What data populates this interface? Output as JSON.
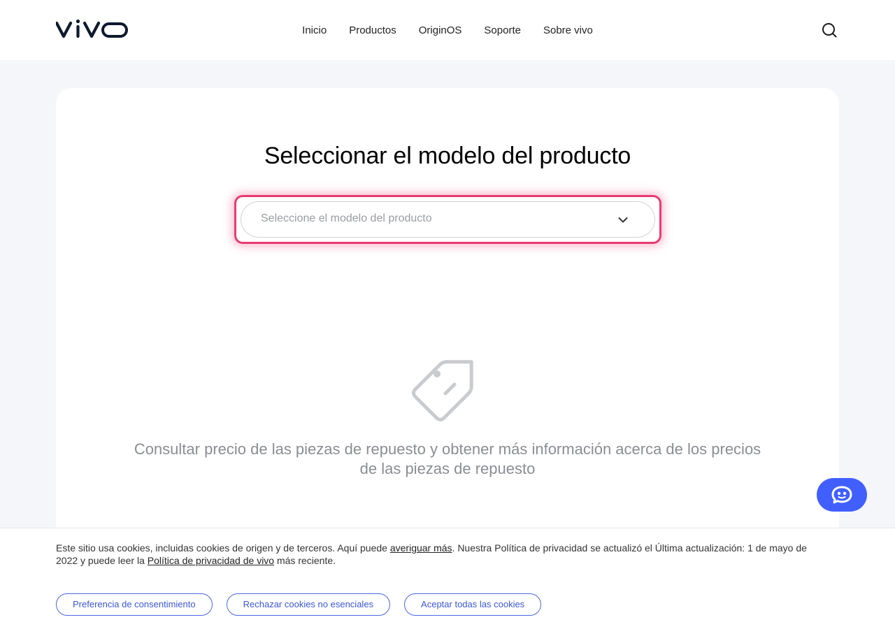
{
  "header": {
    "logo_text": "vivo",
    "nav": [
      {
        "label": "Inicio"
      },
      {
        "label": "Productos"
      },
      {
        "label": "OriginOS"
      },
      {
        "label": "Soporte"
      },
      {
        "label": "Sobre vivo"
      }
    ],
    "search_icon": "search-icon"
  },
  "main": {
    "title": "Seleccionar el modelo del producto",
    "select": {
      "placeholder": "Seleccione el modelo del producto",
      "icon": "chevron-down-icon"
    },
    "empty_state": {
      "icon": "price-tag-icon",
      "text": "Consultar precio de las piezas de repuesto y obtener más información acerca de los precios de las piezas de repuesto"
    }
  },
  "chat": {
    "icon": "chatbot-icon",
    "color": "#415fff"
  },
  "cookie_banner": {
    "text_part1": "Este sitio usa cookies, incluidas cookies de origen y de terceros. Aquí puede ",
    "link1": "averiguar más",
    "text_part2": ". Nuestra Política de privacidad se actualizó el Última actualización: 1 de mayo de 2022 y puede leer la ",
    "link2": "Política de privacidad de vivo",
    "text_part3": " más reciente.",
    "buttons": [
      {
        "label": "Preferencia de consentimiento"
      },
      {
        "label": "Rechazar cookies no esenciales"
      },
      {
        "label": "Aceptar todas las cookies"
      }
    ]
  },
  "colors": {
    "accent": "#415fff",
    "highlight": "#e93a72",
    "button_text": "#3b57d8"
  }
}
